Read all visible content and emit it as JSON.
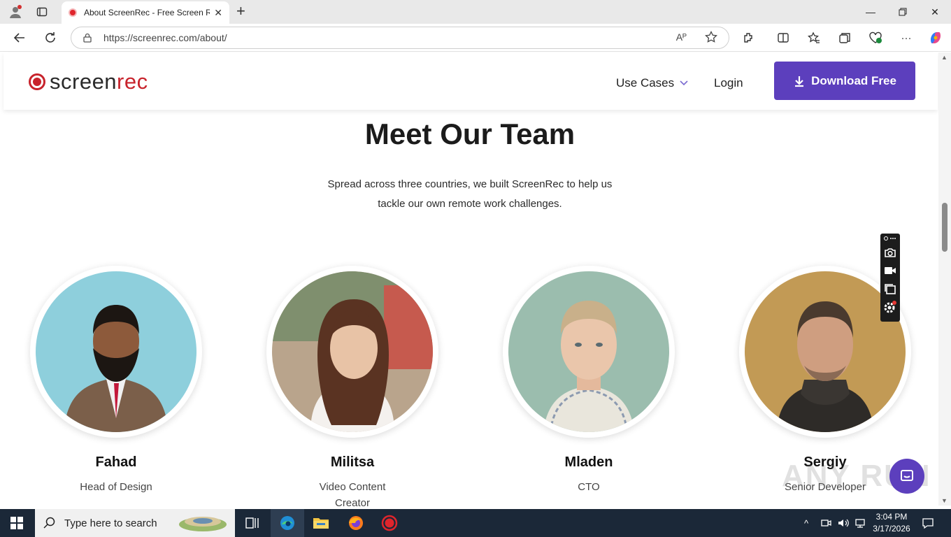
{
  "browser": {
    "tab_title": "About ScreenRec - Free Screen Re",
    "url": "https://screenrec.com/about/",
    "read_aloud": "Aᴾ"
  },
  "site": {
    "logo_part1": "screen",
    "logo_part2": "rec",
    "nav_use_cases": "Use Cases",
    "nav_login": "Login",
    "download_label": "Download Free",
    "brand_color": "#5c3fbd",
    "logo_red": "#c8232c"
  },
  "main": {
    "title": "Meet Our Team",
    "subtitle_line1": "Spread across three countries, we built ScreenRec to help us",
    "subtitle_line2": "tackle our own remote work challenges.",
    "team": [
      {
        "name": "Fahad",
        "role": "Head of Design"
      },
      {
        "name": "Militsa",
        "role_line1": "Video Content",
        "role_line2": "Creator"
      },
      {
        "name": "Mladen",
        "role": "CTO"
      },
      {
        "name": "Sergiy",
        "role": "Senior Developer"
      }
    ]
  },
  "overlay": {
    "watermark": "ANY RUN"
  },
  "taskbar": {
    "search_placeholder": "Type here to search",
    "time": "3:04 PM",
    "date": "3/17/2026"
  }
}
